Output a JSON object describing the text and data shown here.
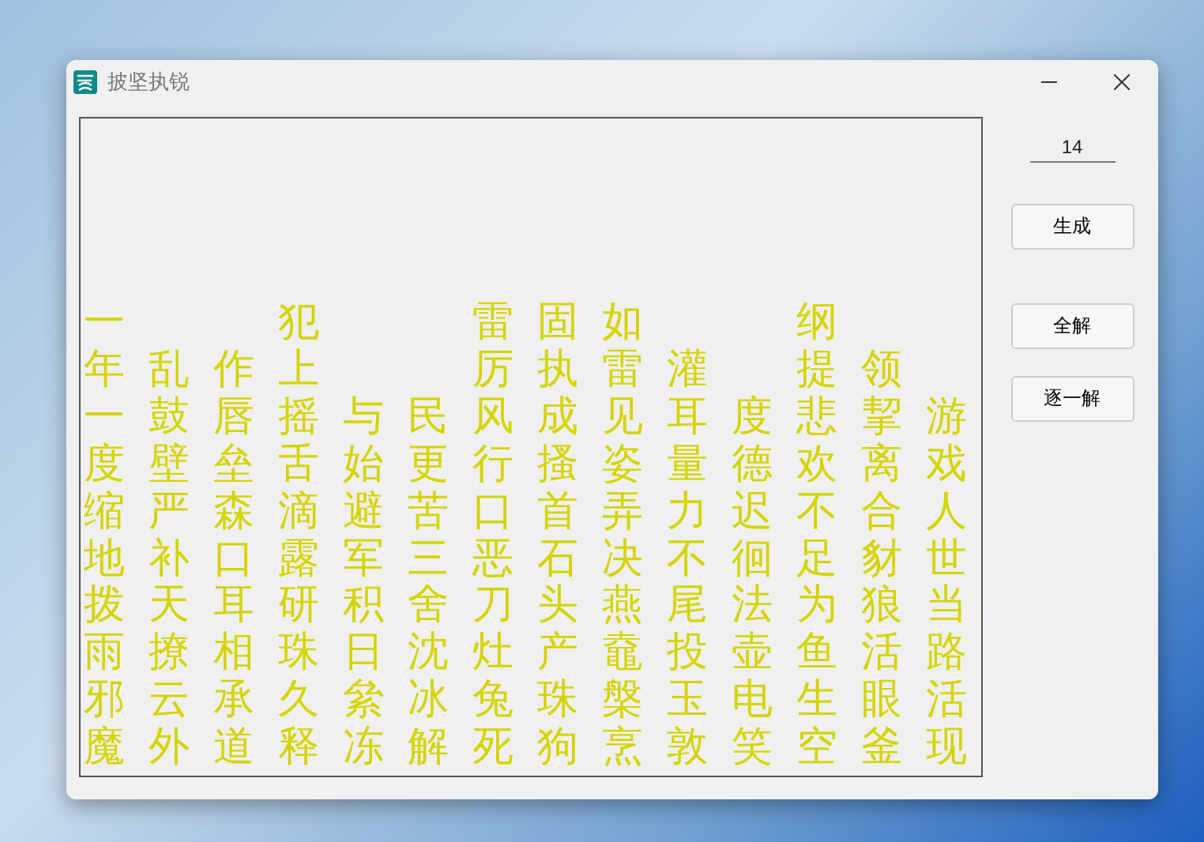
{
  "window": {
    "title": "披坚执锐"
  },
  "columns": [
    "一年一度缩地拨雨邪魔",
    "乱鼓壁严补天撩云外",
    "作唇垒森口耳相承道",
    "犯上摇舌滴露研珠久释",
    "与始避军积日絫冻",
    "民更苦三舍沈冰解",
    "雷厉风行口恶刀灶兔死",
    "固执成搔首石头产珠狗",
    "如雷见姿弄决燕鼀槃烹",
    "灌耳量力不尾投玉敦",
    "度德迟徊法壶电笑",
    "纲提悲欢不足为鱼生空",
    "领挈离合豺狼活眼釜",
    "游戏人世当路活现"
  ],
  "count_field": {
    "value": "14"
  },
  "buttons": [
    {
      "label": "生成",
      "kind": "generate"
    },
    {
      "label": "全解",
      "kind": "solve"
    },
    {
      "label": "逐一解",
      "kind": "solve"
    }
  ]
}
